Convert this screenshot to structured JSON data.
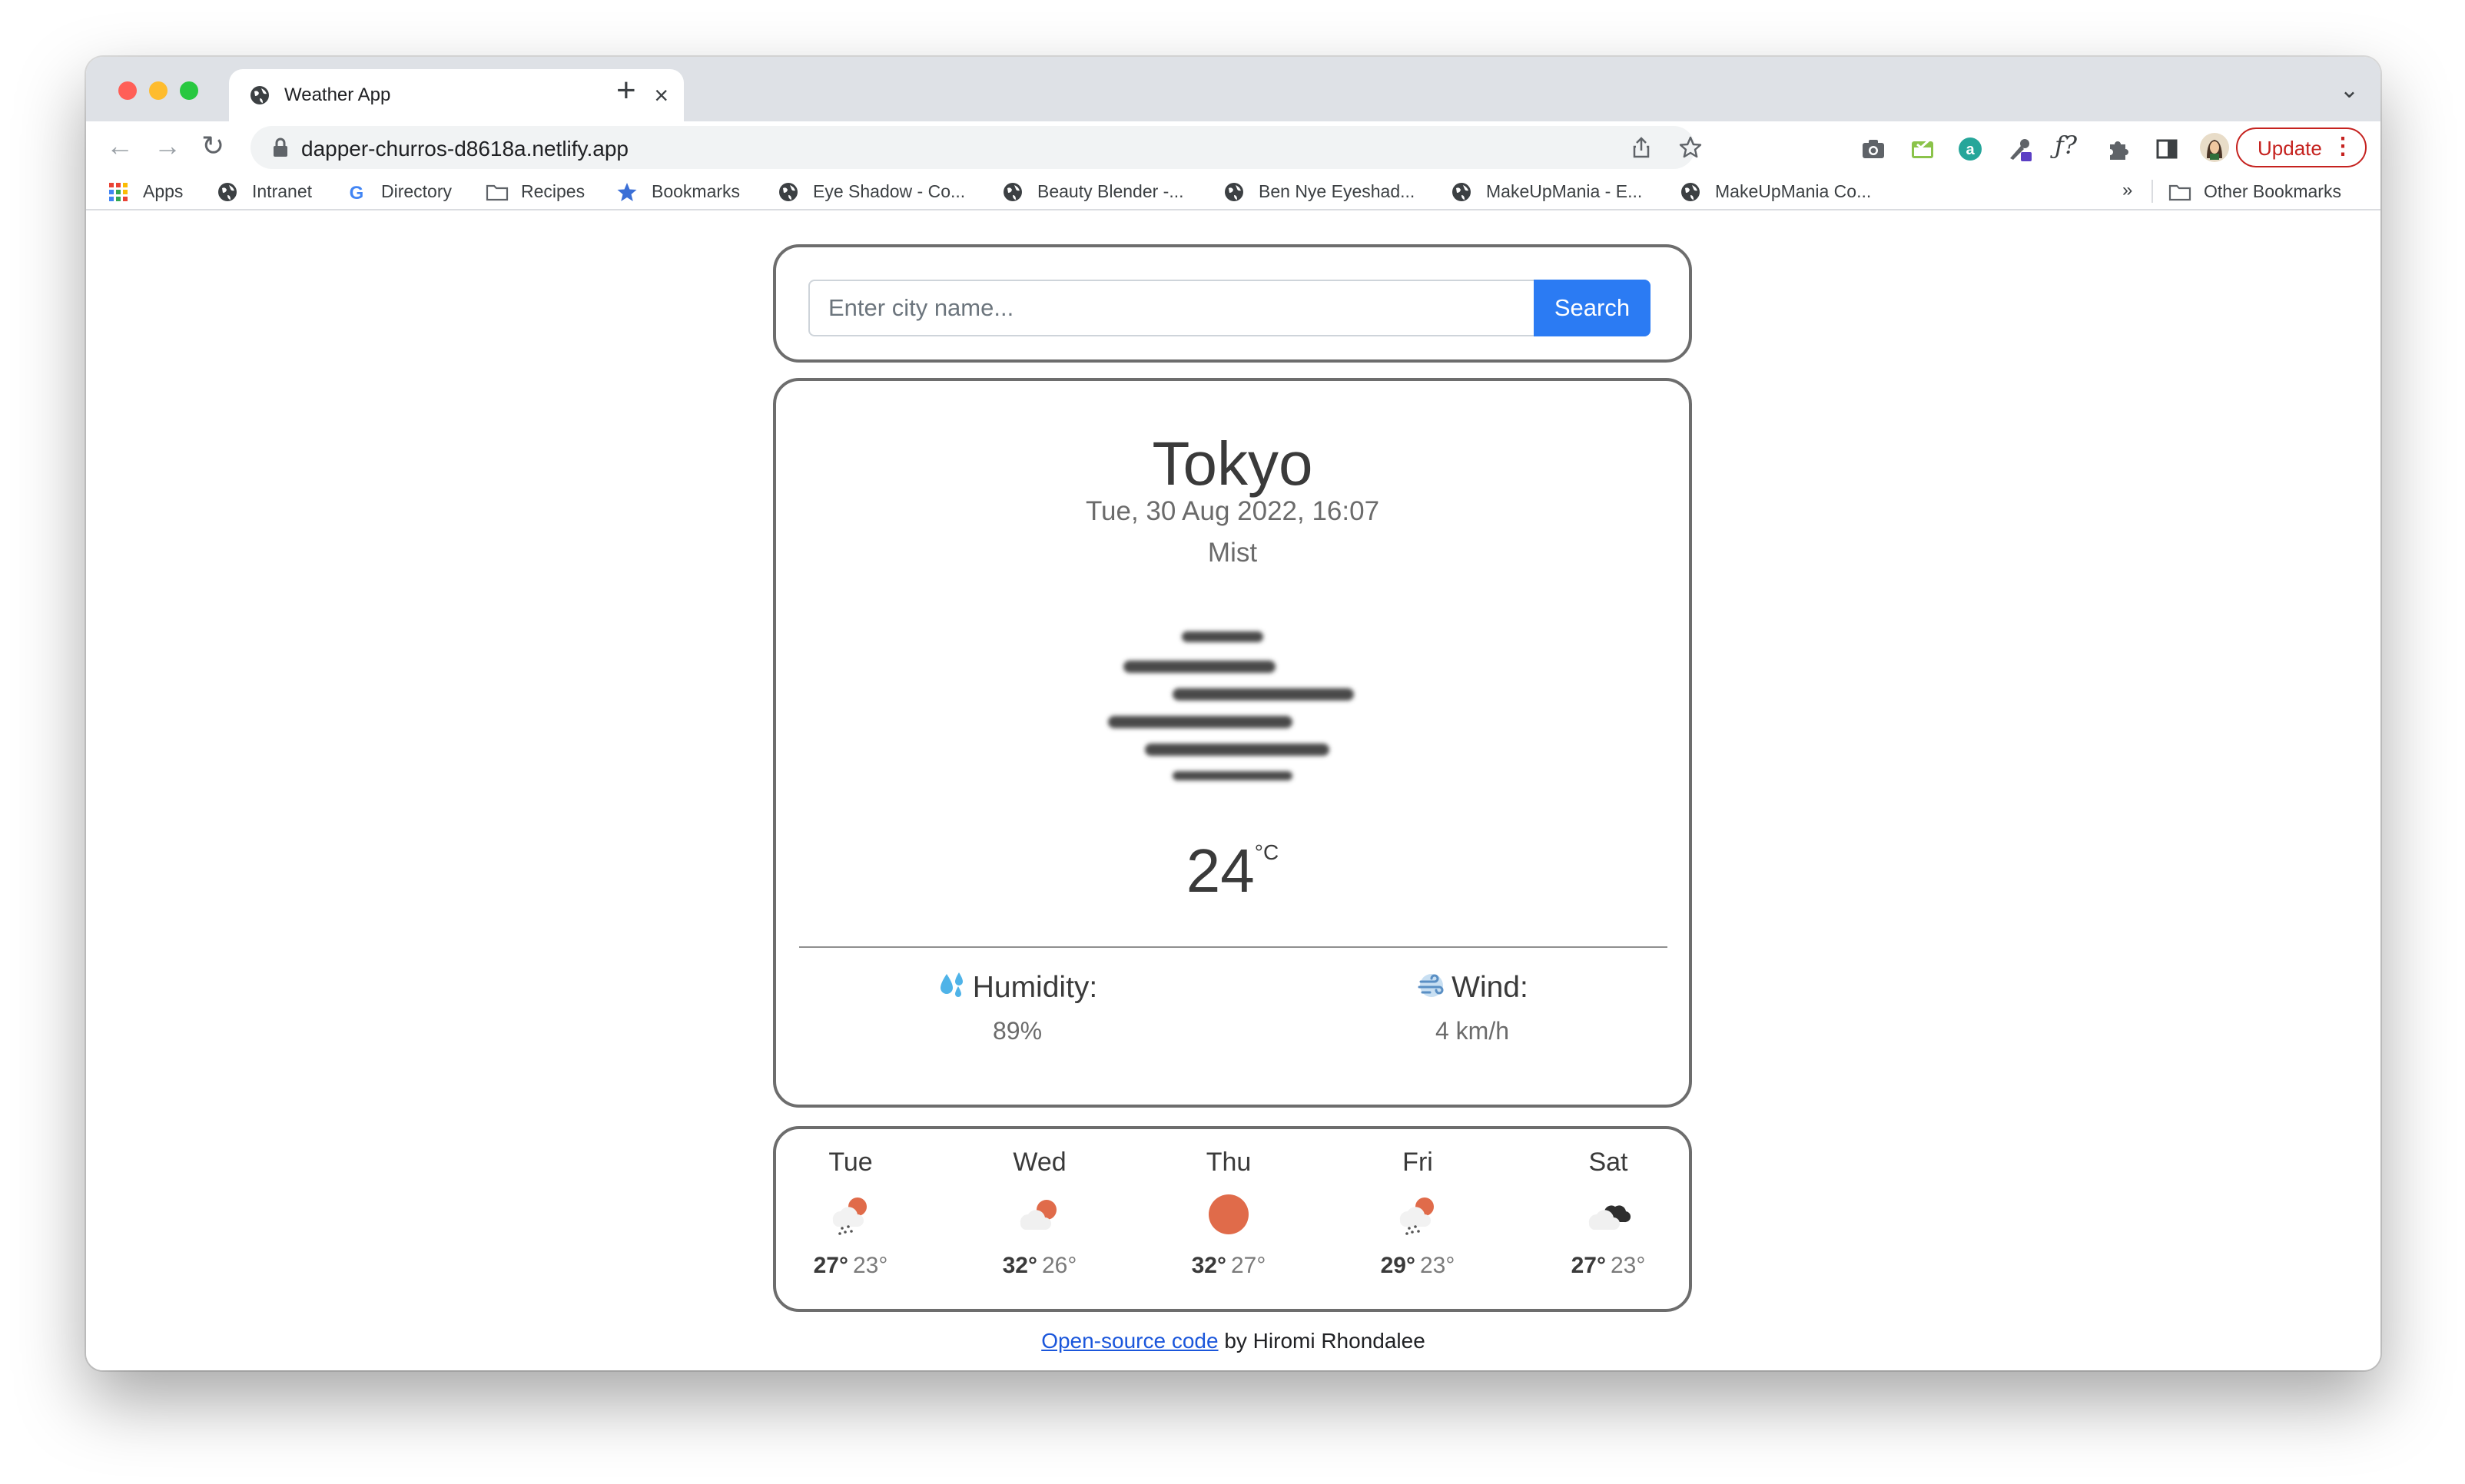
{
  "browser": {
    "tab_title": "Weather App",
    "tab_close": "×",
    "new_tab": "+",
    "tabs_menu": "⌄",
    "nav": {
      "back": "←",
      "forward": "→",
      "reload": "↻"
    },
    "url": "dapper-churros-d8618a.netlify.app",
    "update_label": "Update",
    "update_menu": "⋮",
    "colors": {
      "tabstrip": "#dee1e6",
      "update": "#c5221f"
    }
  },
  "bookmarks": {
    "items": [
      {
        "label": "Apps",
        "icon": "apps-grid-icon"
      },
      {
        "label": "Intranet",
        "icon": "globe-icon"
      },
      {
        "label": "Directory",
        "icon": "google-icon"
      },
      {
        "label": "Recipes",
        "icon": "folder-icon"
      },
      {
        "label": "Bookmarks",
        "icon": "star-icon"
      },
      {
        "label": "Eye Shadow - Co...",
        "icon": "globe-icon"
      },
      {
        "label": "Beauty Blender -...",
        "icon": "globe-icon"
      },
      {
        "label": "Ben Nye Eyeshad...",
        "icon": "globe-icon"
      },
      {
        "label": "MakeUpMania - E...",
        "icon": "globe-icon"
      },
      {
        "label": "MakeUpMania Co...",
        "icon": "globe-icon"
      }
    ],
    "overflow": "»",
    "other_label": "Other Bookmarks"
  },
  "search": {
    "placeholder": "Enter city name...",
    "button_label": "Search",
    "button_color": "#2b7bf3"
  },
  "current": {
    "city": "Tokyo",
    "datetime": "Tue, 30 Aug 2022, 16:07",
    "condition": "Mist",
    "icon": "mist-icon",
    "temperature": "24",
    "unit": "°C",
    "humidity_label": "Humidity:",
    "humidity_value": "89%",
    "humidity_icon": "droplets-icon",
    "wind_label": "Wind:",
    "wind_value": "4 km/h",
    "wind_icon": "wind-icon"
  },
  "forecast": [
    {
      "day": "Tue",
      "high": "27°",
      "low": "23°",
      "icon": "rain-sun-icon"
    },
    {
      "day": "Wed",
      "high": "32°",
      "low": "26°",
      "icon": "cloud-sun-icon"
    },
    {
      "day": "Thu",
      "high": "32°",
      "low": "27°",
      "icon": "sun-icon"
    },
    {
      "day": "Fri",
      "high": "29°",
      "low": "23°",
      "icon": "rain-sun-icon"
    },
    {
      "day": "Sat",
      "high": "27°",
      "low": "23°",
      "icon": "cloud-dark-icon"
    }
  ],
  "footer": {
    "link_text": "Open-source code",
    "suffix": " by Hiromi Rhondalee"
  }
}
